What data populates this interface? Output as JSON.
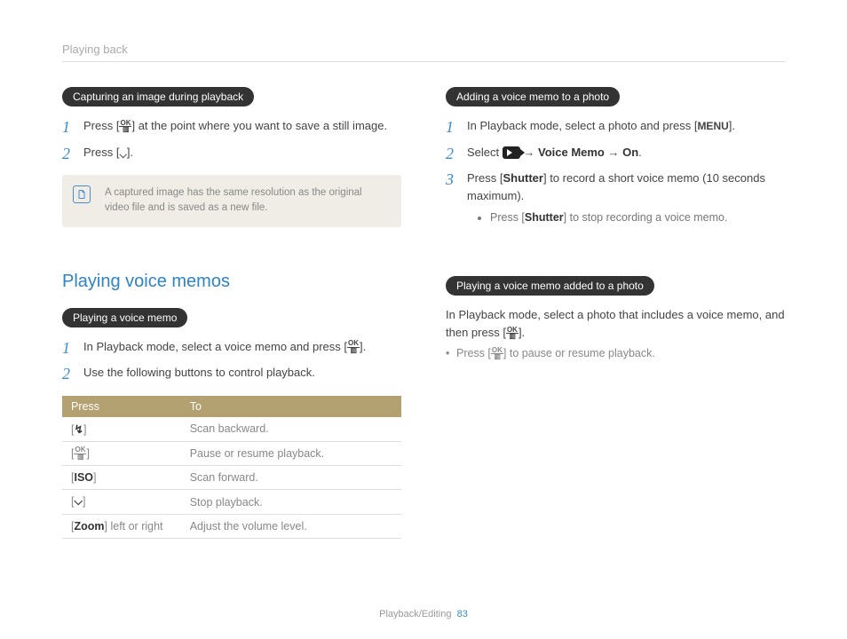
{
  "header": "Playing back",
  "col1": {
    "pill1": "Capturing an image during playback",
    "step1_a": "Press [",
    "step1_b": "] at the point where you want to save a still image.",
    "step2_a": "Press [",
    "step2_b": "].",
    "note": "A captured image has the same resolution as the original video file and is saved as a new file.",
    "section": "Playing voice memos",
    "pill2": "Playing a voice memo",
    "vstep1_a": "In Playback mode, select a voice memo and press [",
    "vstep1_b": "].",
    "vstep2": "Use the following buttons to control playback.",
    "th1": "Press",
    "th2": "To",
    "rows": [
      {
        "press_a": "[",
        "press_glyph": "↯",
        "press_b": "]",
        "to": "Scan backward."
      },
      {
        "press_a": "[",
        "press_glyph": "ok",
        "press_b": "]",
        "to": "Pause or resume playback."
      },
      {
        "press_a": "[",
        "press_glyph": "ISO",
        "press_b": "]",
        "to": "Scan forward."
      },
      {
        "press_a": "[",
        "press_glyph": "⌵",
        "press_b": "]",
        "to": "Stop playback."
      },
      {
        "press_a": "[",
        "press_bold": "Zoom",
        "press_b": "] left or right",
        "to": "Adjust the volume level."
      }
    ]
  },
  "col2": {
    "pill1": "Adding a voice memo to a photo",
    "a1_a": "In Playback mode, select a photo and press [",
    "a1_menu": "MENU",
    "a1_b": "].",
    "a2_a": "Select ",
    "a2_b": " → ",
    "a2_vm": "Voice Memo",
    "a2_c": " → ",
    "a2_on": "On",
    "a2_d": ".",
    "a3_a": "Press [",
    "a3_sh": "Shutter",
    "a3_b": "] to record a short voice memo (10 seconds maximum).",
    "a3_sub_a": "Press [",
    "a3_sub_sh": "Shutter",
    "a3_sub_b": "] to stop recording a voice memo.",
    "pill2": "Playing a voice memo added to a photo",
    "p_a": "In Playback mode, select a photo that includes a voice memo, and then press [",
    "p_b": "].",
    "sub_a": "Press [",
    "sub_b": "] to pause or resume playback."
  },
  "footer": {
    "section": "Playback/Editing",
    "page": "83"
  }
}
